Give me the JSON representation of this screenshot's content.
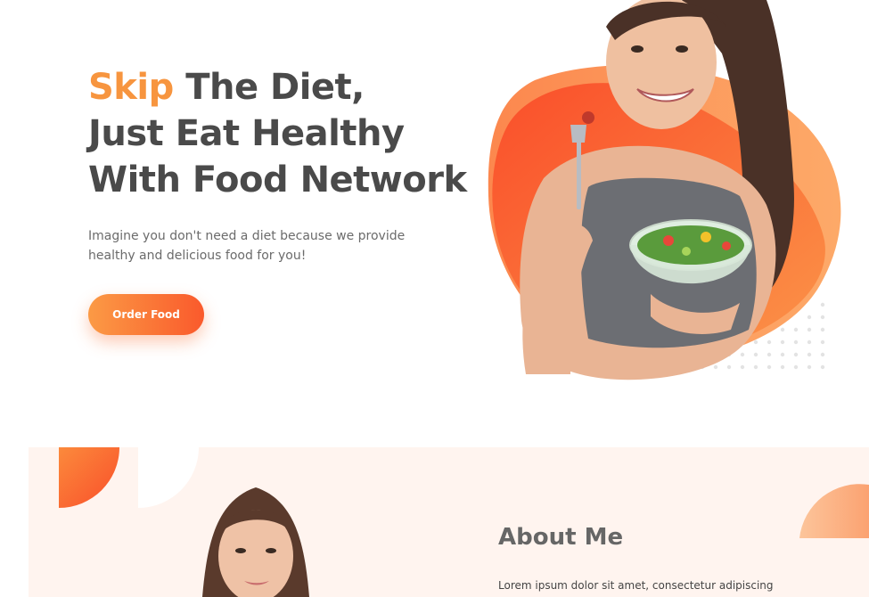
{
  "hero": {
    "title_accent": "Skip",
    "title_rest_line1": " The Diet,",
    "title_line2": "Just Eat Healthy",
    "title_line3": "With Food Network",
    "description": "Imagine you don't need a diet because we provide healthy and delicious food for you!",
    "cta_label": "Order Food"
  },
  "about": {
    "title": "About Me",
    "text": "Lorem ipsum dolor sit amet, consectetur adipiscing"
  },
  "colors": {
    "accent": "#f7953f",
    "button_gradient_start": "#fb9a45",
    "button_gradient_end": "#fa5a2c",
    "heading": "#4a4a4a",
    "about_background": "#fff4ef"
  },
  "images": {
    "hero_photo": "woman-eating-salad-photo",
    "about_photo": "woman-portrait-photo"
  }
}
